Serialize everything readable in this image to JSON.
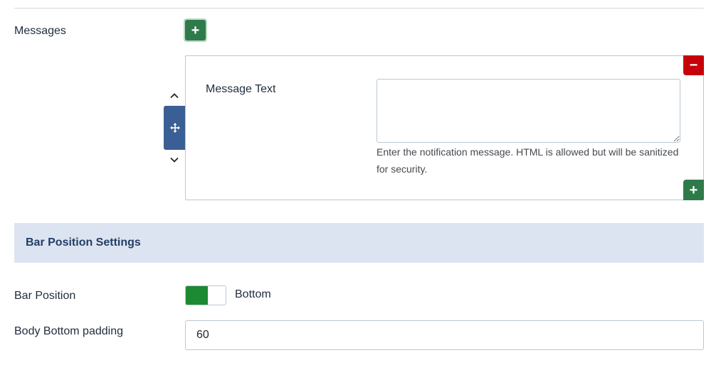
{
  "messages": {
    "label": "Messages",
    "add_icon": "plus-icon",
    "item": {
      "field_label": "Message Text",
      "textarea_value": "",
      "help_text": "Enter the notification message. HTML is allowed but will be sanitized for security.",
      "remove_icon": "minus-icon",
      "add_icon": "plus-icon",
      "move_up_icon": "chevron-up-icon",
      "move_down_icon": "chevron-down-icon",
      "drag_icon": "move-arrows-icon"
    }
  },
  "section": {
    "title": "Bar Position Settings"
  },
  "bar_position": {
    "label": "Bar Position",
    "value_label": "Bottom",
    "state": "on"
  },
  "body_padding": {
    "label": "Body Bottom padding",
    "value": "60"
  },
  "colors": {
    "add_green": "#2f7a4a",
    "remove_red": "#c8000a",
    "handle_blue": "#3a5f94",
    "section_bg": "#dce4f1",
    "switch_green": "#1c8a33"
  }
}
